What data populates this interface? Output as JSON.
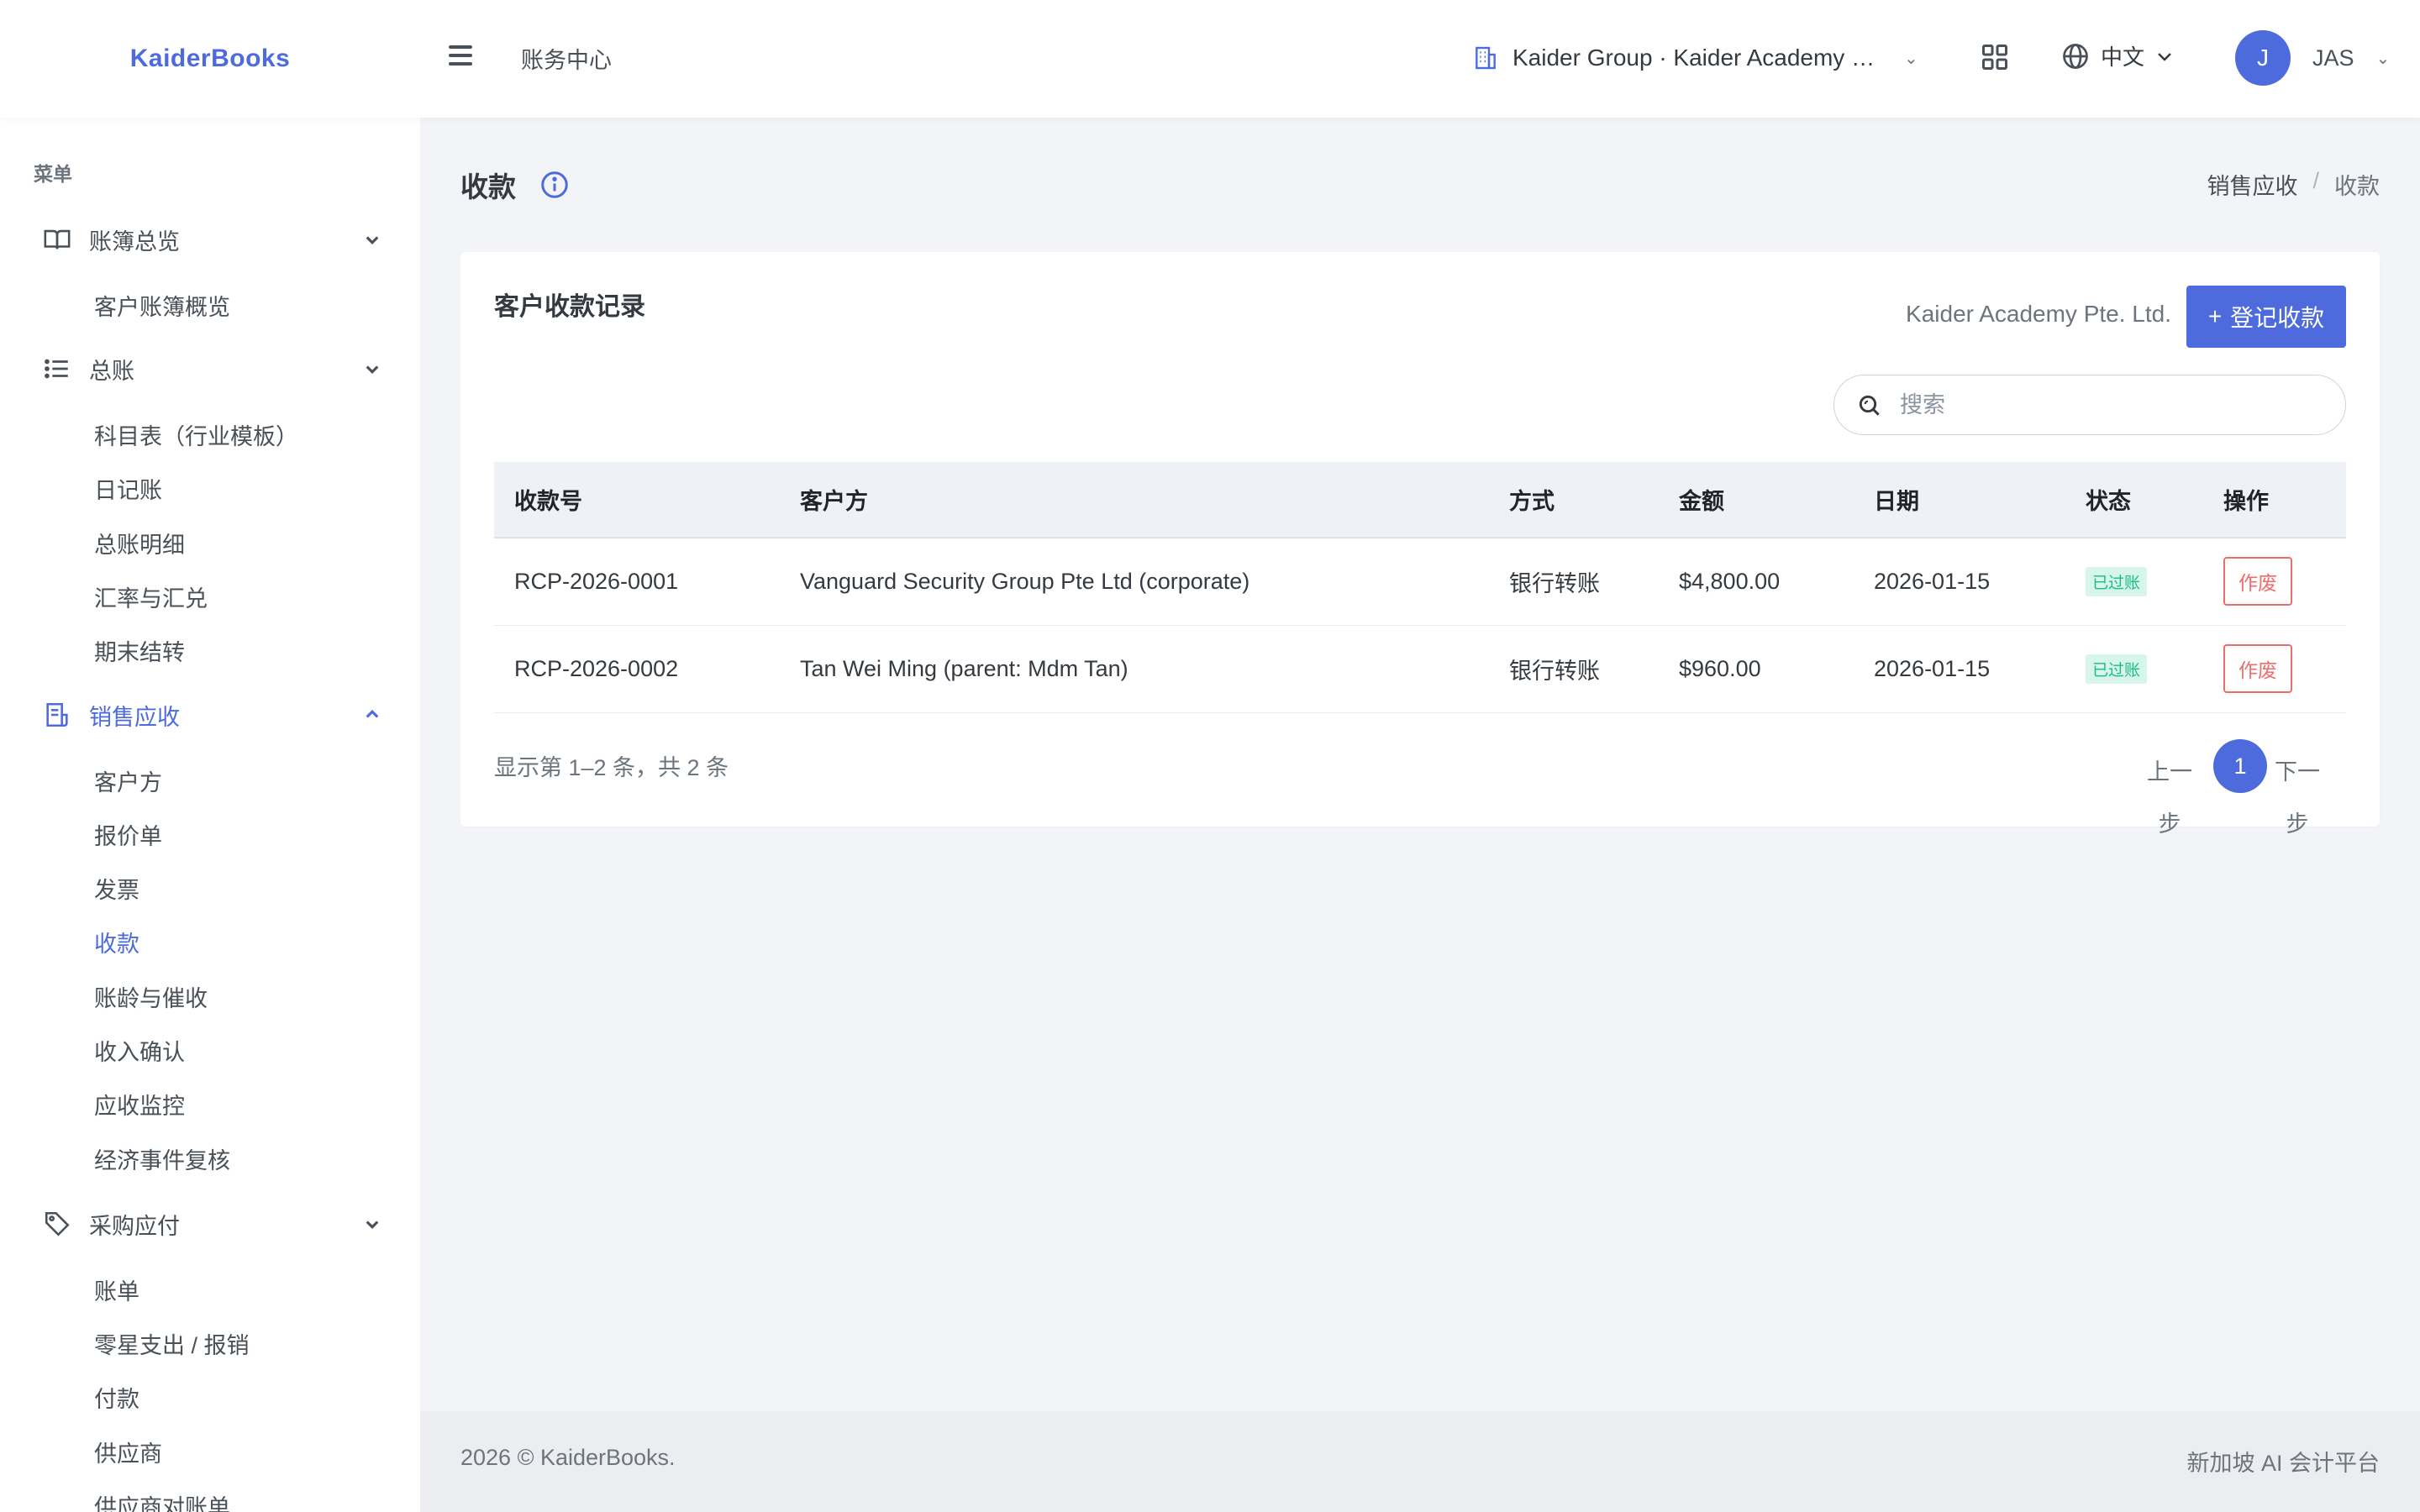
{
  "brand": "KaiderBooks",
  "topbar": {
    "title": "账务中心",
    "org_name": "Kaider Group · Kaider Academy Pte. Ltd.",
    "language": "中文",
    "avatar_initial": "J",
    "user_name": "JAS"
  },
  "sidebar": {
    "menu_title": "菜单",
    "groups": [
      {
        "label": "账簿总览",
        "icon": "book-open-icon",
        "items": [
          "客户账簿概览"
        ]
      },
      {
        "label": "总账",
        "icon": "list-icon",
        "items": [
          "科目表（行业模板）",
          "日记账",
          "总账明细",
          "汇率与汇兑",
          "期末结转"
        ]
      },
      {
        "label": "销售应收",
        "icon": "receipt-icon",
        "items": [
          "客户方",
          "报价单",
          "发票",
          "收款",
          "账龄与催收",
          "收入确认",
          "应收监控",
          "经济事件复核"
        ]
      },
      {
        "label": "采购应付",
        "icon": "tag-icon",
        "items": [
          "账单",
          "零星支出 / 报销",
          "付款",
          "供应商",
          "供应商对账单"
        ]
      }
    ]
  },
  "page": {
    "title": "收款",
    "breadcrumb": [
      "销售应收",
      "收款"
    ]
  },
  "card": {
    "title": "客户收款记录",
    "company": "Kaider Academy Pte. Ltd.",
    "add_button": "登记收款",
    "search_placeholder": "搜索",
    "columns": [
      "收款号",
      "客户方",
      "方式",
      "金额",
      "日期",
      "状态",
      "操作"
    ],
    "rows": [
      {
        "id": "RCP-2026-0001",
        "customer": "Vanguard Security Group Pte Ltd (corporate)",
        "method": "银行转账",
        "amount": "$4,800.00",
        "date": "2026-01-15",
        "status": "已过账",
        "action": "作废"
      },
      {
        "id": "RCP-2026-0002",
        "customer": "Tan Wei Ming (parent: Mdm Tan)",
        "method": "银行转账",
        "amount": "$960.00",
        "date": "2026-01-15",
        "status": "已过账",
        "action": "作废"
      }
    ],
    "showing": "显示第 1–2 条，共 2 条",
    "pager": {
      "prev": "上一步",
      "page": "1",
      "next": "下一步"
    }
  },
  "footer": {
    "left": "2026 © KaiderBooks.",
    "right": "新加坡 AI 会计平台"
  },
  "colors": {
    "accent": "#4d6bdc",
    "danger": "#f06b6b",
    "success": "#1abc89"
  }
}
